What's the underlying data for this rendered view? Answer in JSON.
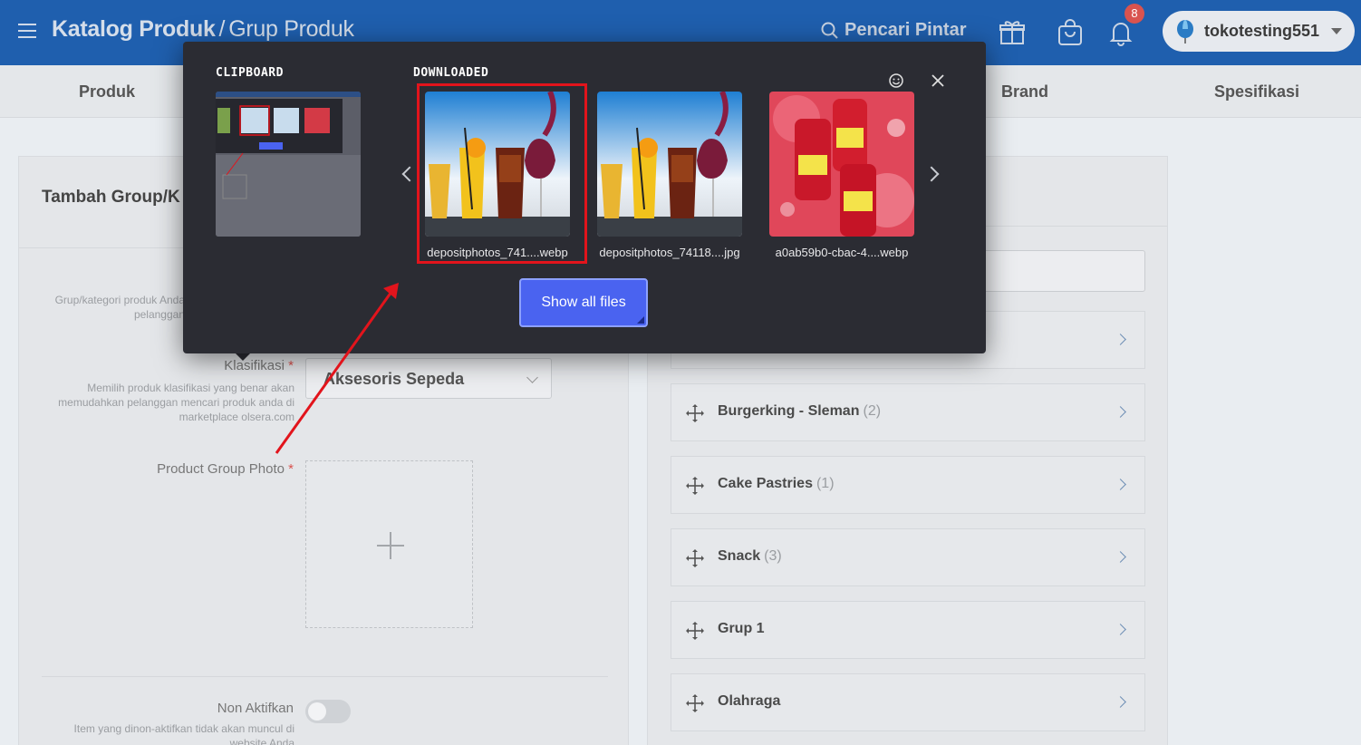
{
  "header": {
    "title": "Katalog Produk",
    "separator": "/",
    "subtitle": "Grup Produk",
    "search_label": "Pencari Pintar",
    "notification_count": "8",
    "account_name": "tokotesting551"
  },
  "tabs": [
    "Produk",
    "Brand",
    "Spesifikasi"
  ],
  "form": {
    "title": "Tambah Group/K",
    "group_help": "Grup/kategori produk Anda\npelanggan",
    "classification_label": "Klasifikasi",
    "required_mark": "*",
    "classification_value": "Aksesoris Sepeda",
    "classification_help_1": "Memilih produk klasifikasi yang benar akan",
    "classification_help_2": "memudahkan pelanggan mencari produk anda di",
    "classification_help_3": "marketplace olsera.com",
    "photo_label": "Product Group Photo",
    "inactive_label": "Non Aktifkan",
    "inactive_help_1": "Item yang dinon-aktifkan tidak akan muncul di",
    "inactive_help_2": "website Anda"
  },
  "groups": [
    {
      "name": "Burgerking - Sleman",
      "count": "(2)"
    },
    {
      "name": "Cake Pastries",
      "count": "(1)"
    },
    {
      "name": "Snack",
      "count": "(3)"
    },
    {
      "name": "Grup 1",
      "count": ""
    },
    {
      "name": "Olahraga",
      "count": ""
    }
  ],
  "popup": {
    "clipboard_title": "CLIPBOARD",
    "downloaded_title": "DOWNLOADED",
    "files": [
      {
        "name": "depositphotos_741....webp"
      },
      {
        "name": "depositphotos_74118....jpg"
      },
      {
        "name": "a0ab59b0-cbac-4....webp"
      }
    ],
    "show_all_label": "Show all files",
    "icons": [
      "emoji-icon",
      "close-icon",
      "chevron-left-icon",
      "chevron-right-icon"
    ]
  },
  "colors": {
    "header_bg": "#1f5fae",
    "popup_bg": "#2b2c33",
    "primary_button": "#4a63f0",
    "annotation_red": "#e2141c"
  }
}
